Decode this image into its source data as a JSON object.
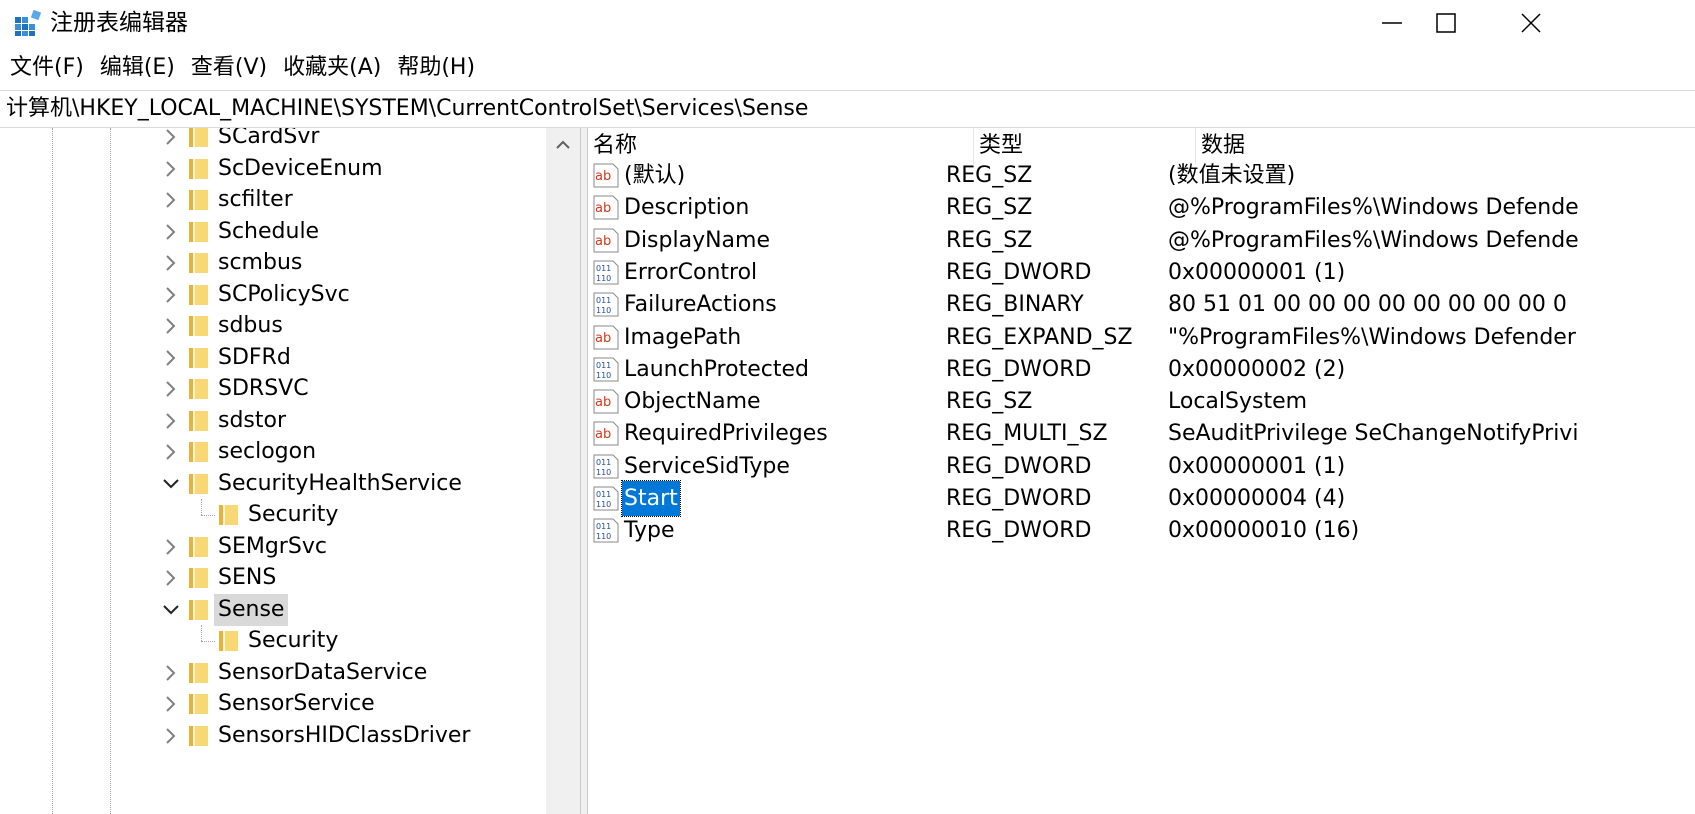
{
  "window": {
    "title": "注册表编辑器"
  },
  "menu": [
    "文件(F)",
    "编辑(E)",
    "查看(V)",
    "收藏夹(A)",
    "帮助(H)"
  ],
  "address": "计算机\\HKEY_LOCAL_MACHINE\\SYSTEM\\CurrentControlSet\\Services\\Sense",
  "tree": {
    "items": [
      {
        "label": "SCardSvr",
        "state": "collapsed",
        "level": 0
      },
      {
        "label": "ScDeviceEnum",
        "state": "collapsed",
        "level": 0
      },
      {
        "label": "scfilter",
        "state": "collapsed",
        "level": 0
      },
      {
        "label": "Schedule",
        "state": "collapsed",
        "level": 0
      },
      {
        "label": "scmbus",
        "state": "collapsed",
        "level": 0
      },
      {
        "label": "SCPolicySvc",
        "state": "collapsed",
        "level": 0
      },
      {
        "label": "sdbus",
        "state": "collapsed",
        "level": 0
      },
      {
        "label": "SDFRd",
        "state": "collapsed",
        "level": 0
      },
      {
        "label": "SDRSVC",
        "state": "collapsed",
        "level": 0
      },
      {
        "label": "sdstor",
        "state": "collapsed",
        "level": 0
      },
      {
        "label": "seclogon",
        "state": "collapsed",
        "level": 0
      },
      {
        "label": "SecurityHealthService",
        "state": "expanded",
        "level": 0
      },
      {
        "label": "Security",
        "state": "leaf",
        "level": 1
      },
      {
        "label": "SEMgrSvc",
        "state": "collapsed",
        "level": 0
      },
      {
        "label": "SENS",
        "state": "collapsed",
        "level": 0
      },
      {
        "label": "Sense",
        "state": "expanded",
        "level": 0,
        "selected": true
      },
      {
        "label": "Security",
        "state": "leaf",
        "level": 1
      },
      {
        "label": "SensorDataService",
        "state": "collapsed",
        "level": 0
      },
      {
        "label": "SensorService",
        "state": "collapsed",
        "level": 0
      },
      {
        "label": "SensorsHIDClassDriver",
        "state": "collapsed",
        "level": 0
      }
    ]
  },
  "list": {
    "columns": [
      "名称",
      "类型",
      "数据"
    ],
    "rows": [
      {
        "icon": "string-value-icon",
        "name": "(默认)",
        "type": "REG_SZ",
        "data": "(数值未设置)"
      },
      {
        "icon": "string-value-icon",
        "name": "Description",
        "type": "REG_SZ",
        "data": "@%ProgramFiles%\\Windows Defende"
      },
      {
        "icon": "string-value-icon",
        "name": "DisplayName",
        "type": "REG_SZ",
        "data": "@%ProgramFiles%\\Windows Defende"
      },
      {
        "icon": "binary-value-icon",
        "name": "ErrorControl",
        "type": "REG_DWORD",
        "data": "0x00000001 (1)"
      },
      {
        "icon": "binary-value-icon",
        "name": "FailureActions",
        "type": "REG_BINARY",
        "data": "80 51 01 00 00 00 00 00 00 00 00 0"
      },
      {
        "icon": "string-value-icon",
        "name": "ImagePath",
        "type": "REG_EXPAND_SZ",
        "data": "\"%ProgramFiles%\\Windows Defender"
      },
      {
        "icon": "binary-value-icon",
        "name": "LaunchProtected",
        "type": "REG_DWORD",
        "data": "0x00000002 (2)"
      },
      {
        "icon": "string-value-icon",
        "name": "ObjectName",
        "type": "REG_SZ",
        "data": "LocalSystem"
      },
      {
        "icon": "string-value-icon",
        "name": "RequiredPrivileges",
        "type": "REG_MULTI_SZ",
        "data": "SeAuditPrivilege SeChangeNotifyPrivi"
      },
      {
        "icon": "binary-value-icon",
        "name": "ServiceSidType",
        "type": "REG_DWORD",
        "data": "0x00000001 (1)"
      },
      {
        "icon": "binary-value-icon",
        "name": "Start",
        "type": "REG_DWORD",
        "data": "0x00000004 (4)",
        "selected": true
      },
      {
        "icon": "binary-value-icon",
        "name": "Type",
        "type": "REG_DWORD",
        "data": "0x00000010 (16)"
      }
    ]
  },
  "colors": {
    "selection": "#0078d7",
    "tree_selection": "#d9d9d9",
    "folder": "#f8d775"
  }
}
